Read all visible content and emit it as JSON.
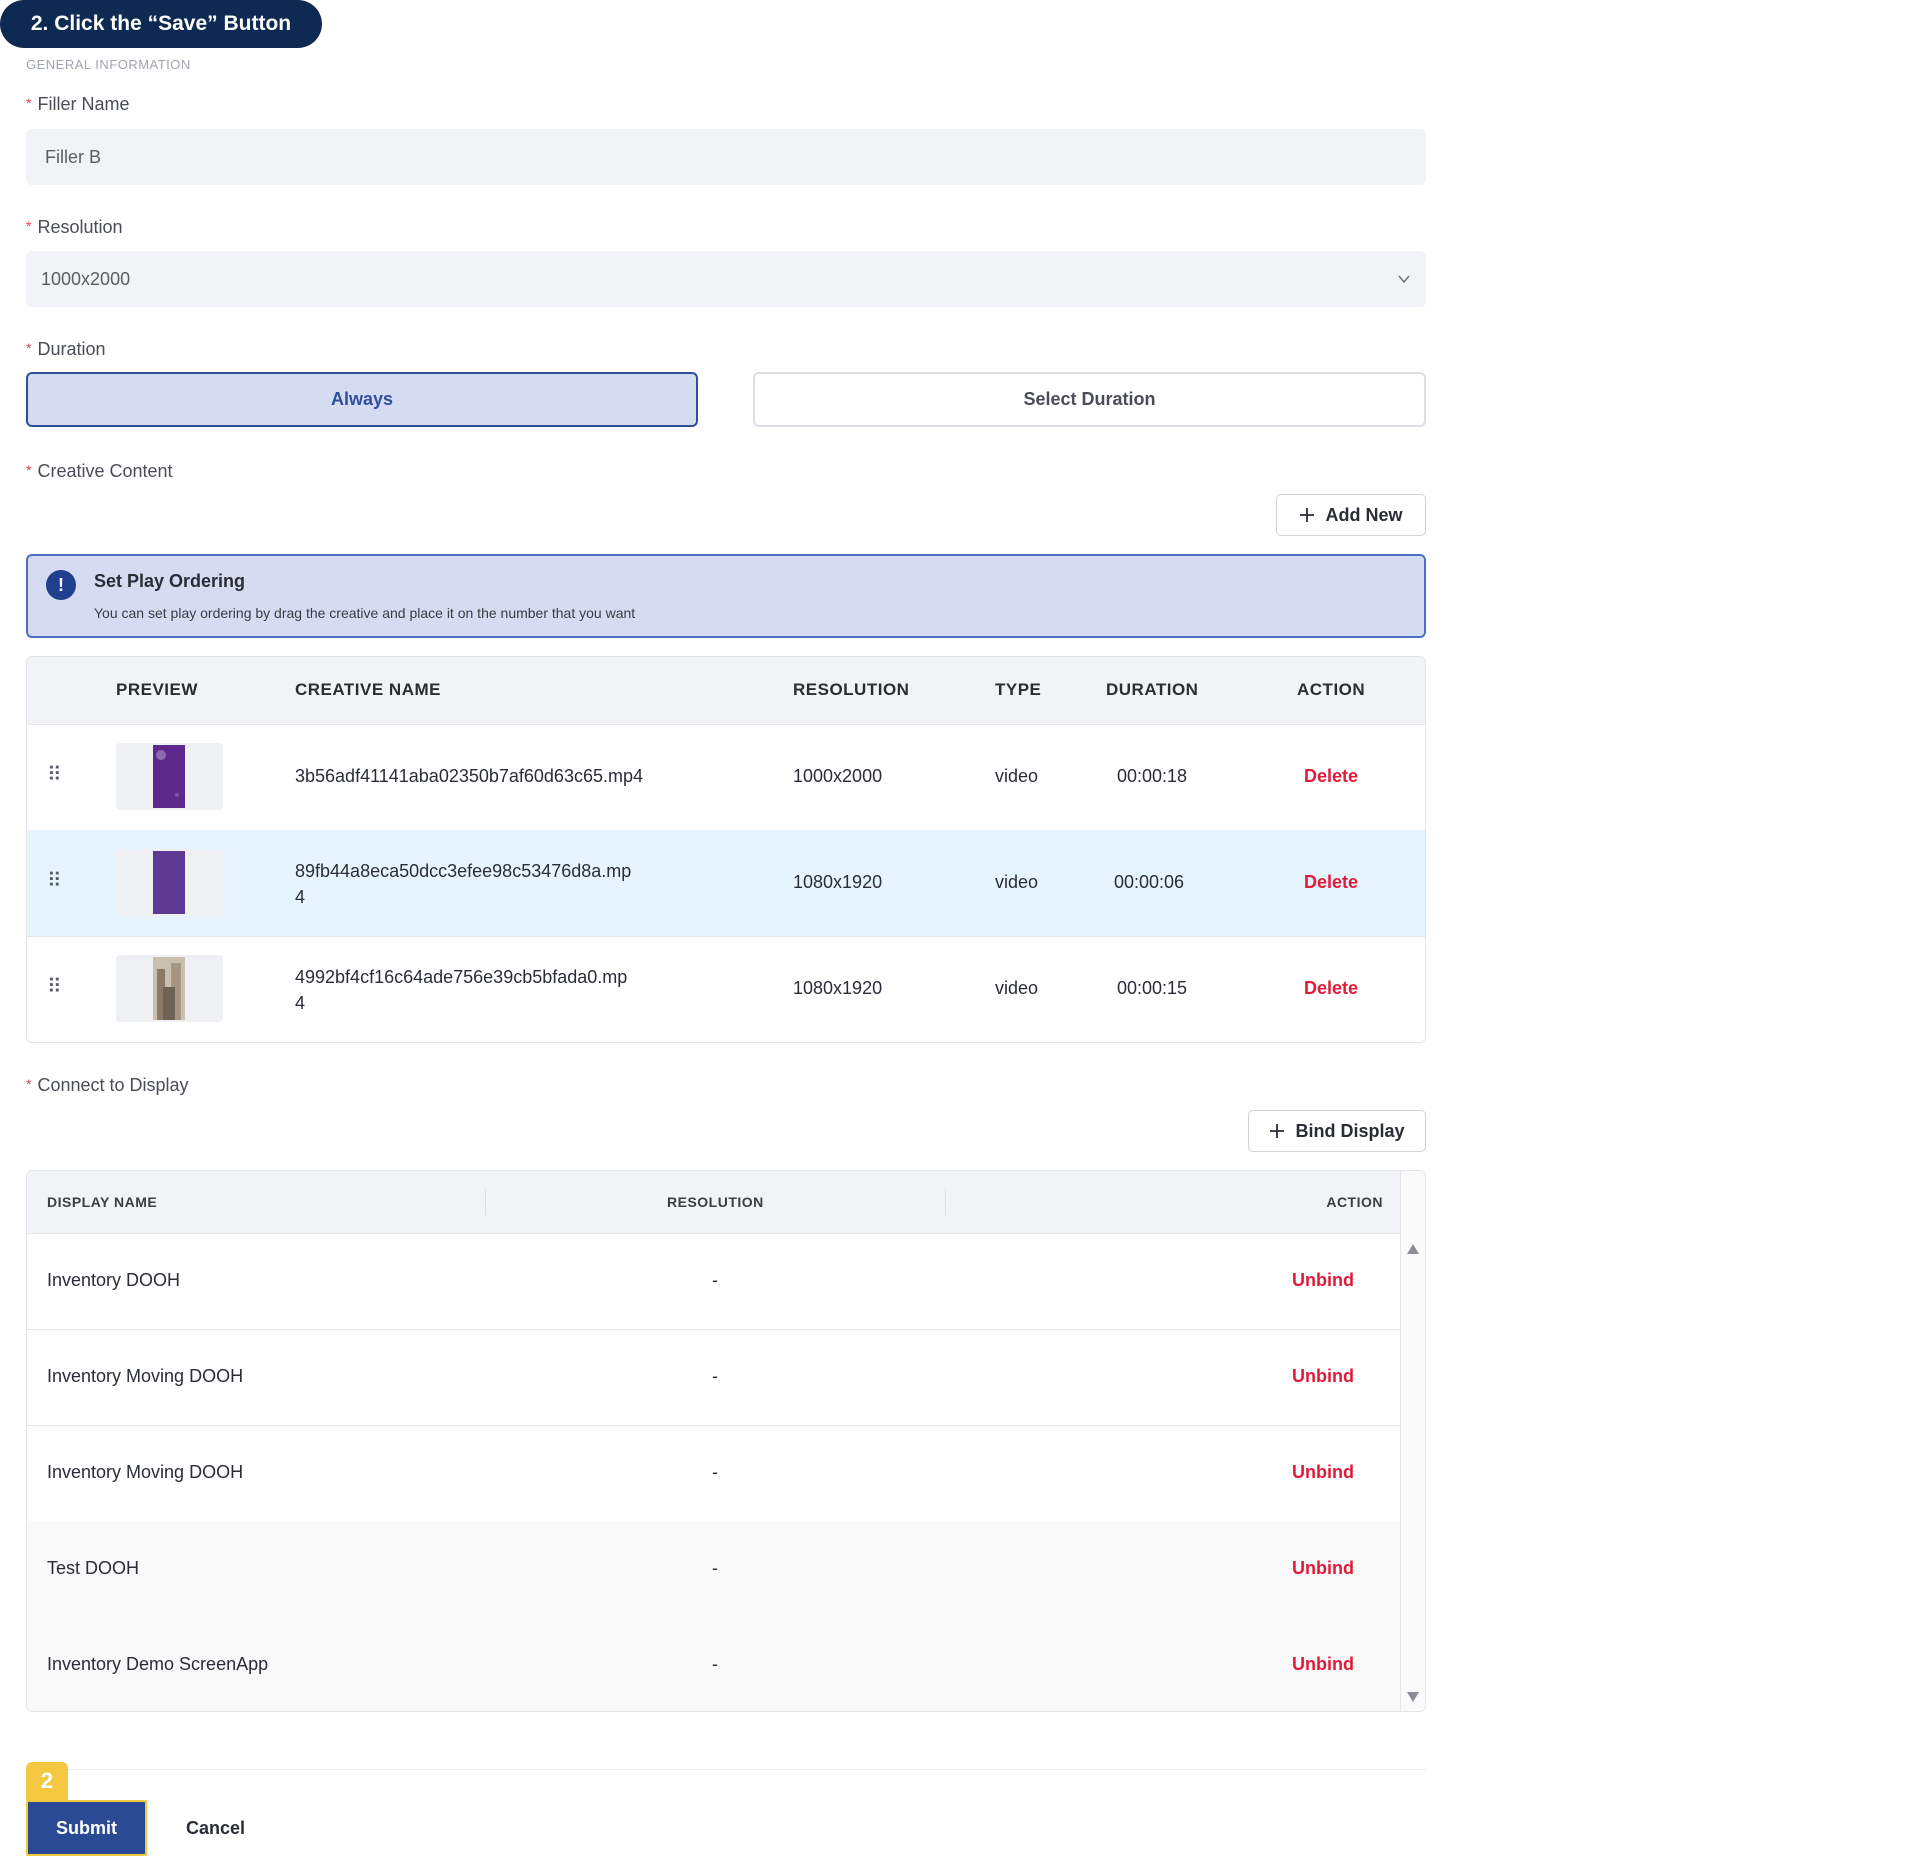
{
  "banner": {
    "text": "2. Click the “Save” Button"
  },
  "section_caption": "GENERAL INFORMATION",
  "required_mark": "*",
  "filler_name": {
    "label": "Filler Name",
    "value": "Filler B"
  },
  "resolution": {
    "label": "Resolution",
    "value": "1000x2000"
  },
  "duration": {
    "label": "Duration",
    "always": "Always",
    "select": "Select Duration"
  },
  "creative_content": {
    "label": "Creative Content",
    "add_new": "Add New",
    "alert": {
      "title": "Set Play Ordering",
      "desc": "You can set play ordering by drag the creative and place it on the number that you want"
    },
    "columns": {
      "preview": "PREVIEW",
      "name": "CREATIVE NAME",
      "resolution": "RESOLUTION",
      "type": "TYPE",
      "duration": "DURATION",
      "action": "ACTION"
    },
    "rows": [
      {
        "name": "3b56adf41141aba02350b7af60d63c65.mp4",
        "name2": "",
        "resolution": "1000x2000",
        "type": "video",
        "duration": "00:00:18",
        "action": "Delete"
      },
      {
        "name": "89fb44a8eca50dcc3efee98c53476d8a.mp",
        "name2": "4",
        "resolution": "1080x1920",
        "type": "video",
        "duration": "00:00:06",
        "action": "Delete"
      },
      {
        "name": "4992bf4cf16c64ade756e39cb5bfada0.mp",
        "name2": "4",
        "resolution": "1080x1920",
        "type": "video",
        "duration": "00:00:15",
        "action": "Delete"
      }
    ]
  },
  "connect_display": {
    "label": "Connect to Display",
    "bind_display": "Bind Display",
    "columns": {
      "display_name": "DISPLAY NAME",
      "resolution": "RESOLUTION",
      "action": "ACTION"
    },
    "rows": [
      {
        "name": "Inventory DOOH",
        "resolution": "-",
        "action": "Unbind"
      },
      {
        "name": "Inventory Moving DOOH",
        "resolution": "-",
        "action": "Unbind"
      },
      {
        "name": "Inventory Moving DOOH",
        "resolution": "-",
        "action": "Unbind"
      },
      {
        "name": "Test DOOH",
        "resolution": "-",
        "action": "Unbind"
      },
      {
        "name": "Inventory Demo ScreenApp",
        "resolution": "-",
        "action": "Unbind"
      }
    ]
  },
  "step_badge": "2",
  "footer": {
    "submit": "Submit",
    "cancel": "Cancel"
  },
  "colors": {
    "primary": "#2b4a94",
    "danger": "#e31b3a",
    "highlight": "#f5c842",
    "banner": "#0f2a52"
  }
}
